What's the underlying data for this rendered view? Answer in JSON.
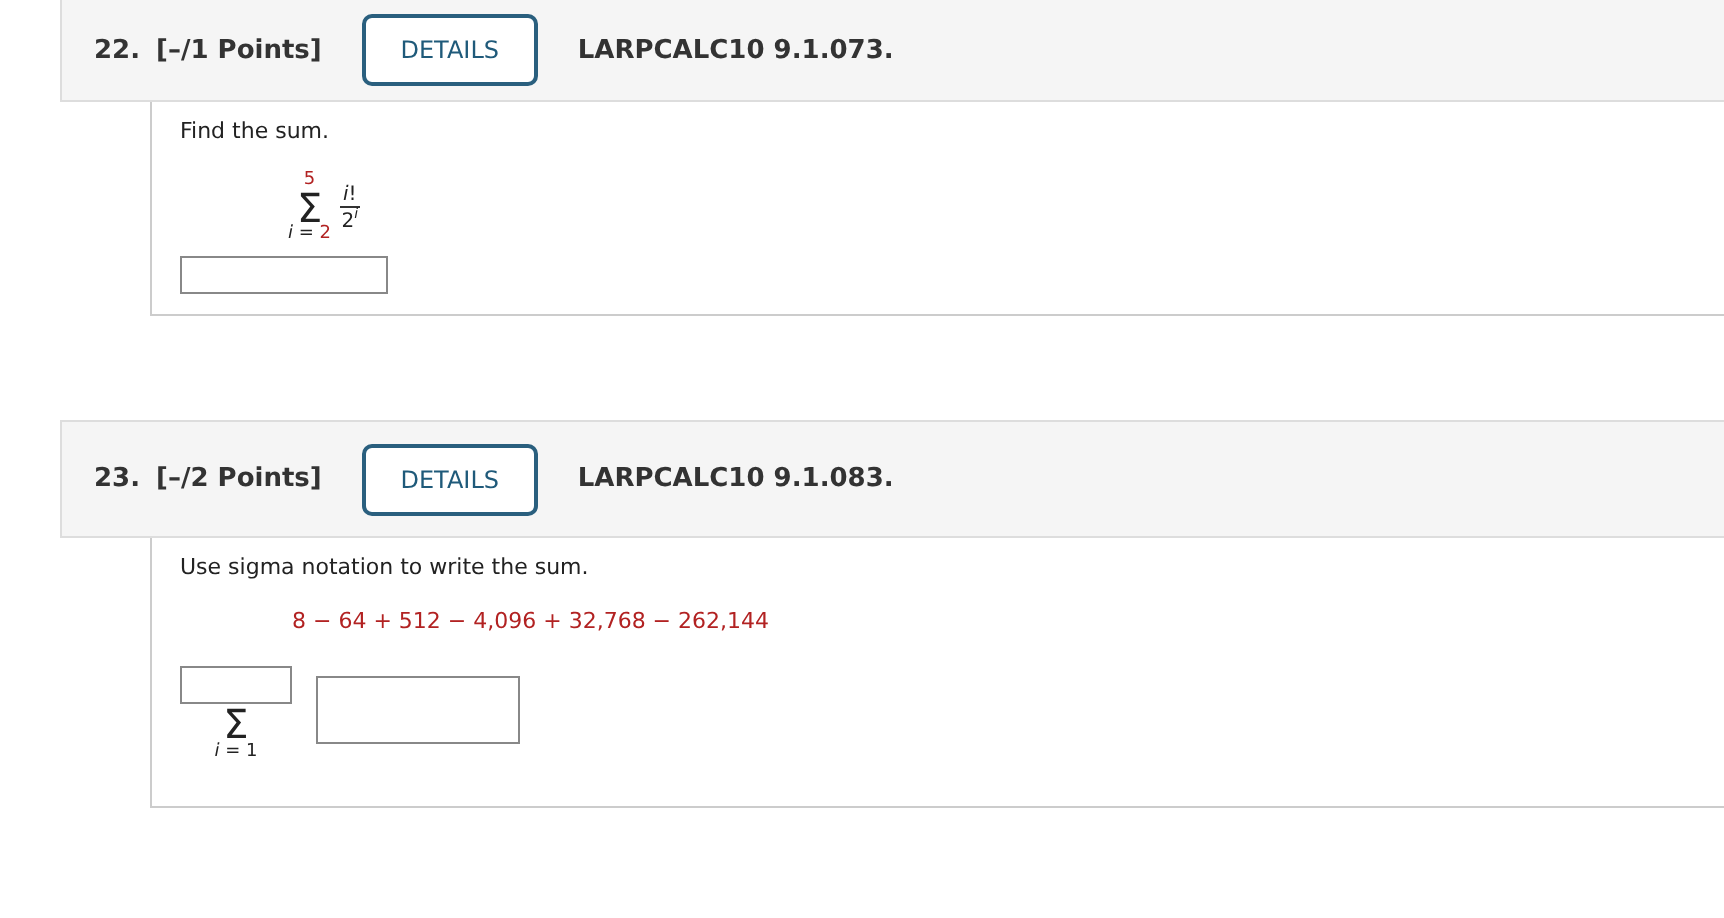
{
  "questions": [
    {
      "number": "22.",
      "points": "[–/1 Points]",
      "details": "DETAILS",
      "code": "LARPCALC10 9.1.073.",
      "prompt": "Find the sum.",
      "kind": "sum",
      "sigma": "Σ",
      "upper": "5",
      "lower_var": "i",
      "lower_eq": "=",
      "lower_value": "2",
      "numerator": "*i*!",
      "denominator_base": "2",
      "denominator_exponent": "i"
    },
    {
      "number": "23.",
      "points": "[–/2 Points]",
      "details": "DETAILS",
      "code": "LARPCALC10 9.1.083.",
      "prompt": "Use sigma notation to write the sum.",
      "kind": "sigma_entry",
      "expression": "8 − 64 + 512 − 4,096 + 32,768 − 262,144",
      "sigma": "Σ",
      "lower": "*i* = 1"
    }
  ]
}
